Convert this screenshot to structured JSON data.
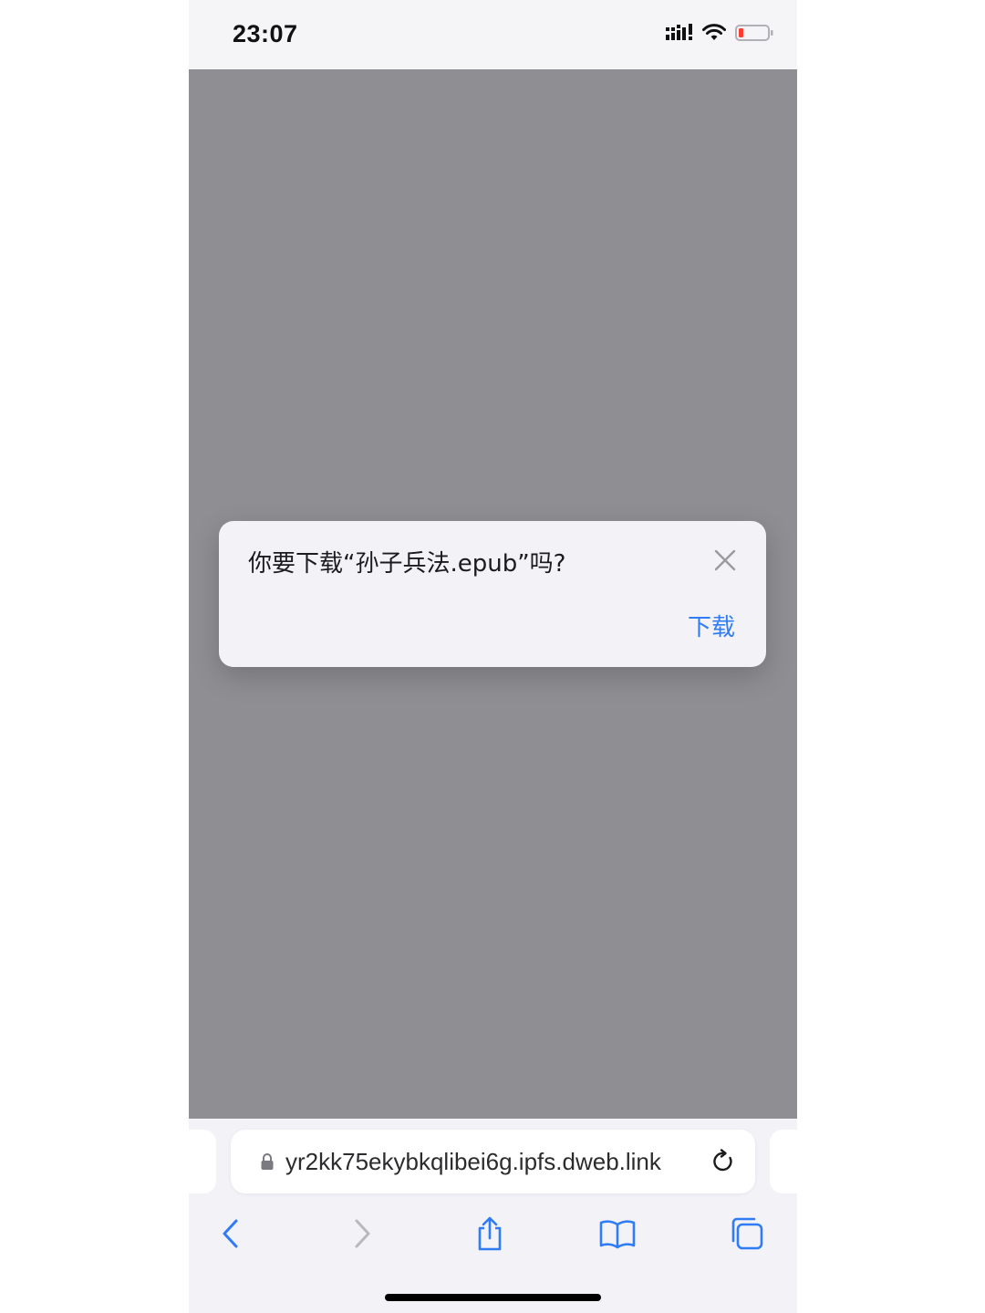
{
  "status_bar": {
    "time": "23:07",
    "signal_icon": "cellular-signal-icon",
    "wifi_icon": "wifi-icon",
    "battery_icon": "battery-low-icon",
    "battery_color": "#ff3b30"
  },
  "dialog": {
    "message": "你要下载“孙子兵法.epub”吗?",
    "close_icon": "close-icon",
    "action_label": "下载",
    "action_color": "#2f7cf6"
  },
  "address_bar": {
    "lock_icon": "lock-icon",
    "url": "yr2kk75ekybkqlibei6g.ipfs.dweb.link",
    "reload_icon": "reload-icon"
  },
  "toolbar": {
    "back_icon": "chevron-left-icon",
    "forward_icon": "chevron-right-icon",
    "share_icon": "share-icon",
    "bookmarks_icon": "book-icon",
    "tabs_icon": "tabs-icon"
  }
}
